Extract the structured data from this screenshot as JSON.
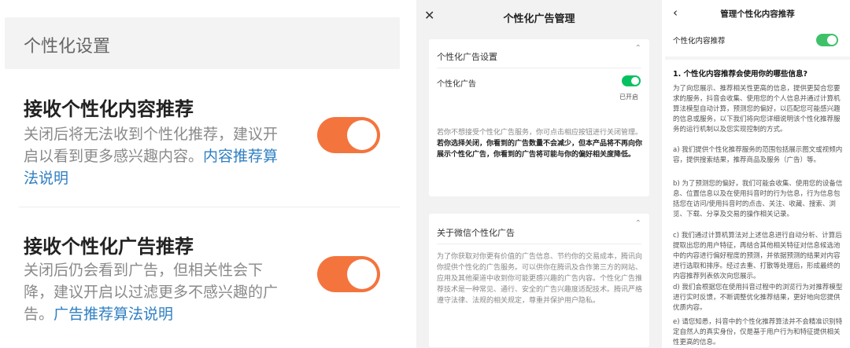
{
  "panel1": {
    "header": "个性化设置",
    "content": {
      "title": "接收个性化内容推荐",
      "desc": "关闭后将无法收到个性化推荐，建议开启以看到更多感兴趣内容。",
      "link": "内容推荐算法说明",
      "toggle_on": true
    },
    "ads": {
      "title": "接收个性化广告推荐",
      "desc": "关闭后仍会看到广告，但相关性会下降，建议开启以过滤更多不感兴趣的广告。",
      "link": "广告推荐算法说明",
      "toggle_on": true
    },
    "accent": "#f4743d"
  },
  "panel2": {
    "close": "✕",
    "title": "个性化广告管理",
    "card1": {
      "title": "个性化广告设置",
      "toggle_label": "个性化广告",
      "toggle_state": "已开启",
      "para_normal": "若你不想接受个性化广告服务，你可点击相应按钮进行关闭管理。",
      "para_bold": "若你选择关闭，你看到的广告数量不会减少，但本产品将不再向你展示个性化广告，你看到的广告将可能与你的偏好相关度降低。"
    },
    "card2": {
      "title": "关于微信个性化广告",
      "para": "为了你获取对你更有价值的广告信息、节约你的交易成本，腾讯向你提供个性化的广告服务。可以供你在腾讯及合作第三方的网站、应用及其他渠道中收到你可能更感兴趣的广告内容。个性化广告推荐技术是一种常见、通行、安全的广告兴趣度适配技术。腾讯严格遵守法律、法规的相关规定，尊重并保护用户隐私。"
    },
    "accent": "#07c160"
  },
  "panel3": {
    "back": "‹",
    "title": "管理个性化内容推荐",
    "toggle_label": "个性化内容推荐",
    "question": "1. 个性化内容推荐会使用你的哪些信息?",
    "intro": "为了向您展示、推荐相关性更高的信息，提供更契合您要求的服务，抖音会收集、使用您的个人信息并通过计算机算法模型自动计算，预测您的偏好，以匹配您可能感兴趣的信息或服务，以下我们将向您详细说明该个性化推荐服务的运行机制以及您实现控制的方式。",
    "a": "a) 我们提供个性化推荐服务的范围包括展示图文或视频内容，提供搜索结果，推荐商品及服务（广告）等。",
    "b": "b) 为了预测您的偏好，我们可能会收集、使用您的设备信息、位置信息以及在使用抖音时的行为信息，行为信息包括您在访问/使用抖音时的点击、关注、收藏、搜索、浏览、下载、分享及交易的操作相关记录。",
    "c": "c) 我们通过计算机算法对上述信息进行自动分析、计算后提取出您的用户特征，再结合其他相关特征对信息候选池中的内容进行偏好程度的预测，并依据预测的结果对内容进行选取和排序。经过去重、打散等处理后，形成最终的内容推荐列表依次向您展示。",
    "d": "d) 我们会根据您在使用抖音过程中的浏览行为对推荐模型进行实时反馈，不断调整优化推荐结果，更好地向您提供优质内容。",
    "e": "e) 请您知悉，抖音中的个性化推荐算法并不会精准识别特定自然人的真实身份，仅是基于用户行为和特征提供相关性更高的信息。",
    "accent": "#3fc16a"
  }
}
